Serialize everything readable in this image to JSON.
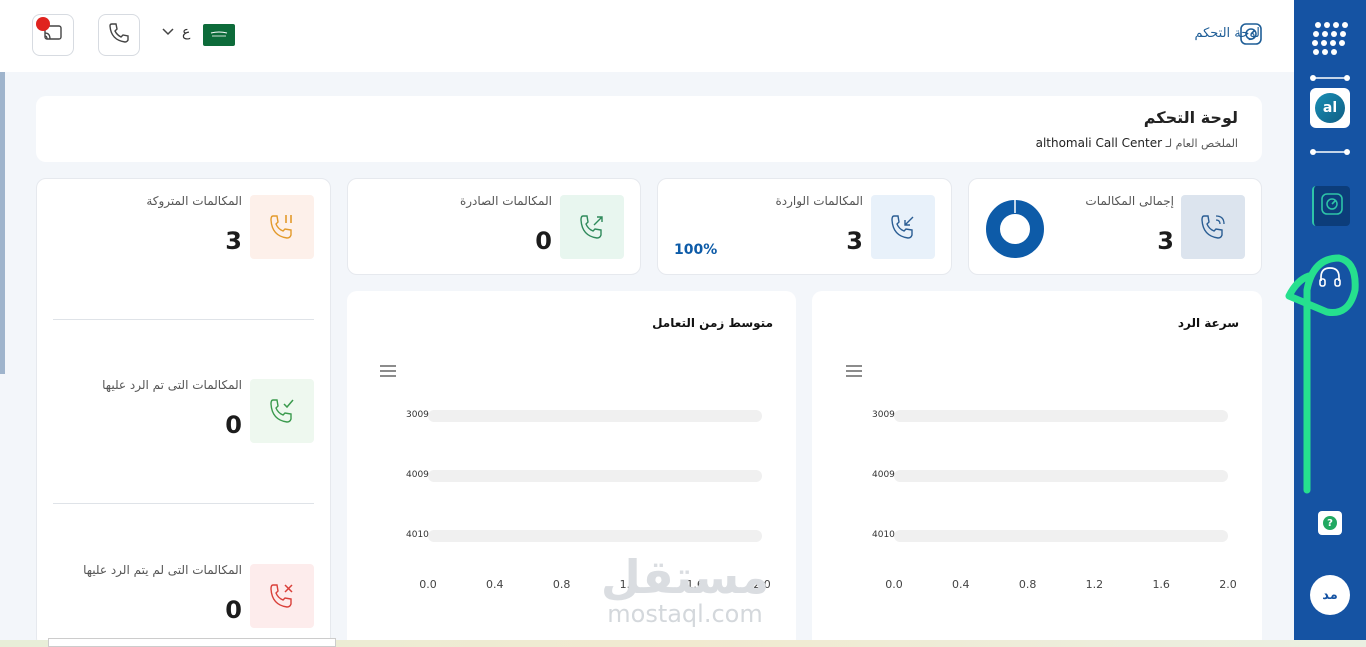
{
  "header": {
    "brand_title": "لوحة التحكم",
    "language_label": "ع"
  },
  "page": {
    "title": "لوحة التحكم",
    "subtitle_prefix": "الملخص العام لـ",
    "company_name": "althomali Call Center"
  },
  "stats": {
    "total": {
      "label": "إجمالى المكالمات",
      "value": "3"
    },
    "incoming": {
      "label": "المكالمات الواردة",
      "value": "3",
      "percent": "100%"
    },
    "outgoing": {
      "label": "المكالمات الصادرة",
      "value": "0"
    },
    "abandoned": {
      "label": "المكالمات المتروكة",
      "value": "3"
    },
    "answered": {
      "label": "المكالمات التى تم الرد عليها",
      "value": "0"
    },
    "unanswered": {
      "label": "المكالمات التى لم يتم الرد عليها",
      "value": "0"
    }
  },
  "sidebar": {
    "avatar_text": "al",
    "help_text": "?",
    "user_initials": "مد"
  },
  "charts": {
    "response_speed": {
      "title": "سرعة الرد",
      "menu_icon": "hamburger-icon"
    },
    "avg_handling": {
      "title": "متوسط زمن التعامل",
      "menu_icon": "hamburger-icon"
    }
  },
  "chart_data": [
    {
      "type": "bar",
      "orientation": "horizontal",
      "title": "سرعة الرد",
      "categories": [
        "3009",
        "4009",
        "4010"
      ],
      "values": [
        0,
        0,
        0
      ],
      "xlim": [
        0,
        2
      ],
      "xticks": [
        "0.0",
        "0.4",
        "0.8",
        "1.2",
        "1.6",
        "2.0"
      ]
    },
    {
      "type": "bar",
      "orientation": "horizontal",
      "title": "متوسط زمن التعامل",
      "categories": [
        "3009",
        "4009",
        "4010"
      ],
      "values": [
        0,
        0,
        0
      ],
      "xlim": [
        0,
        2
      ],
      "xticks": [
        "0.0",
        "0.4",
        "0.8",
        "1.2",
        "1.6",
        "2.0"
      ]
    }
  ],
  "donut": {
    "value": 100
  },
  "watermark": {
    "arabic": "مستقل",
    "latin": "mostaql.com"
  },
  "colors": {
    "sidebar": "#1553a3",
    "accent_blue": "#0d5ba8",
    "annotation_green": "#26e08e"
  }
}
